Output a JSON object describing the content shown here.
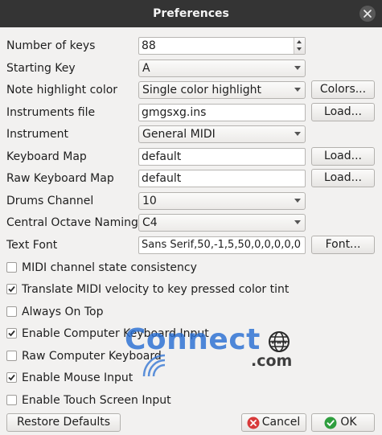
{
  "window": {
    "title": "Preferences"
  },
  "form": {
    "number_of_keys": {
      "label": "Number of keys",
      "value": "88"
    },
    "starting_key": {
      "label": "Starting Key",
      "value": "A"
    },
    "note_highlight_color": {
      "label": "Note highlight color",
      "value": "Single color highlight",
      "button": "Colors..."
    },
    "instruments_file": {
      "label": "Instruments file",
      "value": "gmgsxg.ins",
      "button": "Load..."
    },
    "instrument": {
      "label": "Instrument",
      "value": "General MIDI"
    },
    "keyboard_map": {
      "label": "Keyboard Map",
      "value": "default",
      "button": "Load..."
    },
    "raw_keyboard_map": {
      "label": "Raw Keyboard Map",
      "value": "default",
      "button": "Load..."
    },
    "drums_channel": {
      "label": "Drums Channel",
      "value": "10"
    },
    "central_octave_naming": {
      "label": "Central Octave Naming",
      "value": "C4"
    },
    "text_font": {
      "label": "Text Font",
      "value": "Sans Serif,50,-1,5,50,0,0,0,0,0",
      "button": "Font..."
    }
  },
  "checkboxes": [
    {
      "label": "MIDI channel state consistency",
      "checked": false
    },
    {
      "label": "Translate MIDI velocity to key pressed color tint",
      "checked": true
    },
    {
      "label": "Always On Top",
      "checked": false
    },
    {
      "label": "Enable Computer Keyboard Input",
      "checked": true
    },
    {
      "label": "Raw Computer Keyboard",
      "checked": false
    },
    {
      "label": "Enable Mouse Input",
      "checked": true
    },
    {
      "label": "Enable Touch Screen Input",
      "checked": false
    }
  ],
  "footer": {
    "restore_defaults": "Restore Defaults",
    "cancel": "Cancel",
    "ok": "OK"
  },
  "watermark": {
    "text": "Connect",
    "suffix": ".com",
    "top": "www"
  },
  "colors": {
    "titlebar": "#343434",
    "dialog_bg": "#f2f1f0",
    "cancel_icon": "#d83a3a",
    "ok_icon": "#2e9e3e",
    "watermark": "#286ed2"
  }
}
